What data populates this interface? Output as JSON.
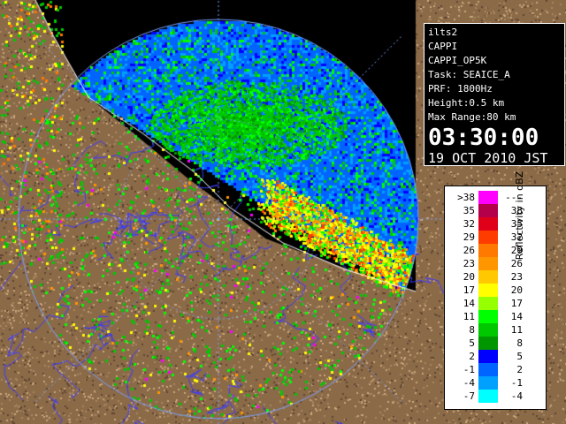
{
  "info": {
    "station": "ilts2",
    "product": "CAPPI",
    "product_code": "CAPPI_OP5K",
    "task": "Task: SEAICE_A",
    "prf": "PRF: 1800Hz",
    "height": "Height:0.5 km",
    "max_range": "Max Range:80 km",
    "time": "03:30:00",
    "date": "19 OCT 2010 JST"
  },
  "legend": {
    "title": "Reflectivity in dBZ",
    "rows": [
      {
        "left": ">38",
        "right": "---",
        "color": "#ff00ff"
      },
      {
        "left": "35",
        "right": "38",
        "color": "#b4004b"
      },
      {
        "left": "32",
        "right": "35",
        "color": "#e0001a"
      },
      {
        "left": "29",
        "right": "32",
        "color": "#ff3c00"
      },
      {
        "left": "26",
        "right": "29",
        "color": "#ff7800"
      },
      {
        "left": "23",
        "right": "26",
        "color": "#ff9600"
      },
      {
        "left": "20",
        "right": "23",
        "color": "#ffc800"
      },
      {
        "left": "17",
        "right": "20",
        "color": "#ffff00"
      },
      {
        "left": "14",
        "right": "17",
        "color": "#96ff00"
      },
      {
        "left": "11",
        "right": "14",
        "color": "#00ff00"
      },
      {
        "left": "8",
        "right": "11",
        "color": "#00c800"
      },
      {
        "left": "5",
        "right": "8",
        "color": "#009600"
      },
      {
        "left": "2",
        "right": "5",
        "color": "#0000ff"
      },
      {
        "left": "-1",
        "right": "2",
        "color": "#0064ff"
      },
      {
        "left": "-4",
        "right": "-1",
        "color": "#00a0ff"
      },
      {
        "left": "-7",
        "right": "-4",
        "color": "#00ffff"
      }
    ]
  },
  "colors": {
    "background": "#000000",
    "land": "#8b6a48",
    "land_dark": "#5e4630",
    "range_ring": "#7aa0ff",
    "coast": "#ffffff",
    "rivers": "#3a3aff"
  },
  "icons": [
    "radar-range-ring",
    "coastline",
    "river-network"
  ]
}
